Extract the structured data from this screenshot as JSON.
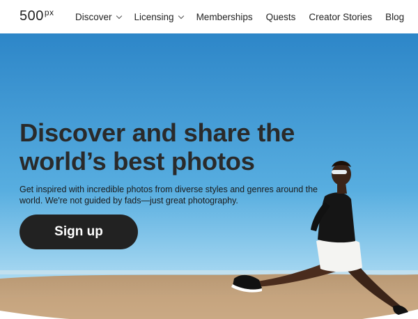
{
  "brand": {
    "logo_main": "500",
    "logo_sup": "px"
  },
  "nav": {
    "items": [
      {
        "label": "Discover",
        "dropdown": true
      },
      {
        "label": "Licensing",
        "dropdown": true
      },
      {
        "label": "Memberships",
        "dropdown": false
      },
      {
        "label": "Quests",
        "dropdown": false
      },
      {
        "label": "Creator Stories",
        "dropdown": false
      },
      {
        "label": "Blog",
        "dropdown": false
      }
    ]
  },
  "hero": {
    "headline": "Discover and share the world’s best photos",
    "subtext": "Get inspired with incredible photos from diverse styles and genres around the world. We're not guided by fads—just great photography.",
    "cta_label": "Sign up"
  },
  "colors": {
    "sky_top": "#2b86c9",
    "sky_bottom": "#a6d8f2",
    "sand": "#c2a07c",
    "button_bg": "#222222",
    "text_dark": "#2a2a2a"
  }
}
